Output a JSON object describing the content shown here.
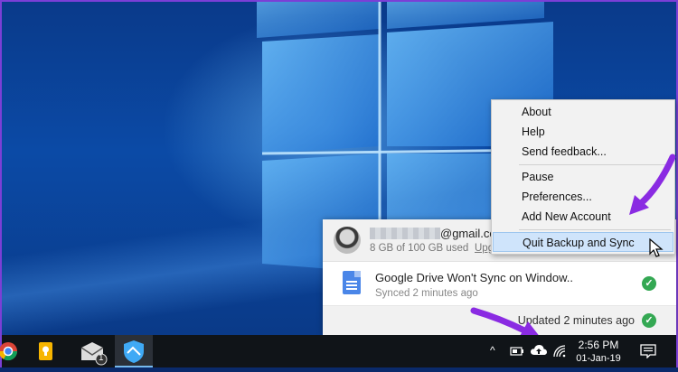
{
  "context_menu": {
    "items": [
      {
        "label": "About"
      },
      {
        "label": "Help"
      },
      {
        "label": "Send feedback..."
      },
      {
        "label": "Pause"
      },
      {
        "label": "Preferences..."
      },
      {
        "label": "Add New Account"
      },
      {
        "label": "Quit Backup and Sync"
      }
    ]
  },
  "drive_panel": {
    "account_email_domain": "@gmail.com",
    "storage_text": "8 GB of 100 GB used",
    "upgrade_link": "Upg",
    "file": {
      "name": "Google Drive Won't Sync on Window..",
      "status": "Synced 2 minutes ago"
    },
    "footer_status": "Updated 2 minutes ago"
  },
  "taskbar": {
    "mail_badge": "1",
    "tray_chevron": "^",
    "clock_time": "2:56 PM",
    "clock_date": "01-Jan-19"
  },
  "colors": {
    "accent_arrow": "#8a2be2",
    "highlight": "#cfe4fb",
    "check_green": "#34a853"
  }
}
